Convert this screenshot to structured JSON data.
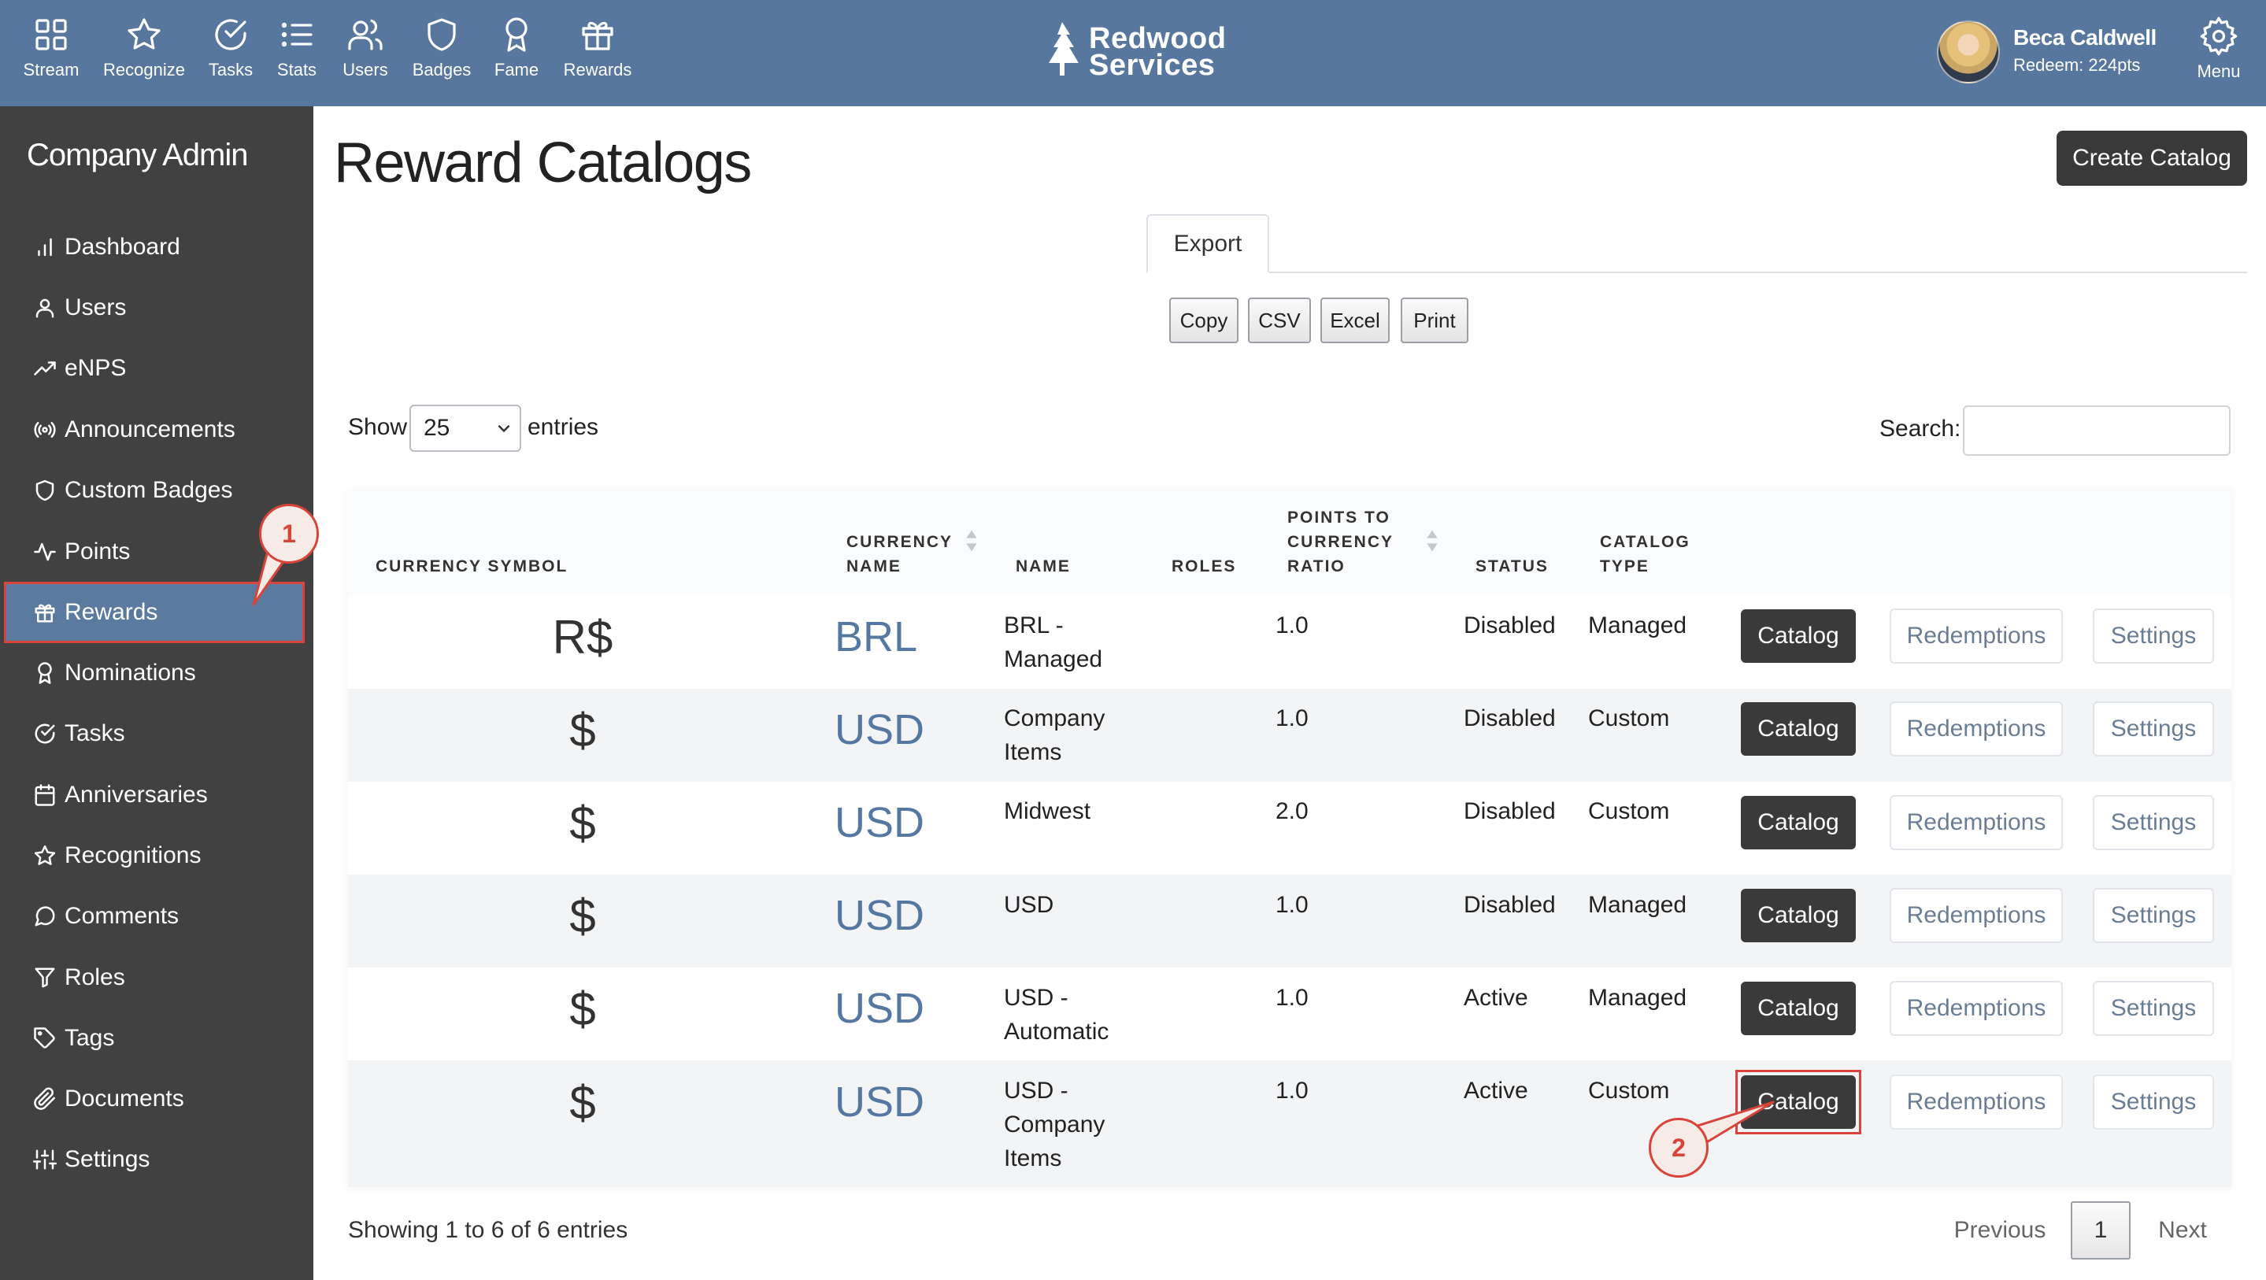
{
  "topnav": {
    "items": [
      {
        "label": "Stream",
        "icon": "grid-icon"
      },
      {
        "label": "Recognize",
        "icon": "star-icon"
      },
      {
        "label": "Tasks",
        "icon": "check-circle-icon"
      },
      {
        "label": "Stats",
        "icon": "list-icon"
      },
      {
        "label": "Users",
        "icon": "users-icon"
      },
      {
        "label": "Badges",
        "icon": "shield-icon"
      },
      {
        "label": "Fame",
        "icon": "award-icon"
      },
      {
        "label": "Rewards",
        "icon": "gift-icon"
      }
    ],
    "brand_line1": "Redwood",
    "brand_line2": "Services",
    "user_name": "Beca Caldwell",
    "user_points": "Redeem: 224pts",
    "menu_label": "Menu"
  },
  "sidebar": {
    "title": "Company Admin",
    "items": [
      {
        "label": "Dashboard",
        "icon": "bar-chart-icon"
      },
      {
        "label": "Users",
        "icon": "user-icon"
      },
      {
        "label": "eNPS",
        "icon": "trending-up-icon"
      },
      {
        "label": "Announcements",
        "icon": "broadcast-icon"
      },
      {
        "label": "Custom Badges",
        "icon": "shield-icon"
      },
      {
        "label": "Points",
        "icon": "activity-icon"
      },
      {
        "label": "Rewards",
        "icon": "gift-icon"
      },
      {
        "label": "Nominations",
        "icon": "award-icon"
      },
      {
        "label": "Tasks",
        "icon": "check-circle-icon"
      },
      {
        "label": "Anniversaries",
        "icon": "calendar-icon"
      },
      {
        "label": "Recognitions",
        "icon": "star-icon"
      },
      {
        "label": "Comments",
        "icon": "message-circle-icon"
      },
      {
        "label": "Roles",
        "icon": "filter-icon"
      },
      {
        "label": "Tags",
        "icon": "tag-icon"
      },
      {
        "label": "Documents",
        "icon": "paperclip-icon"
      },
      {
        "label": "Settings",
        "icon": "sliders-icon"
      }
    ],
    "active_item": "Rewards"
  },
  "main": {
    "title": "Reward Catalogs",
    "create_button": "Create Catalog",
    "tab_export": "Export",
    "export_buttons": [
      "Copy",
      "CSV",
      "Excel",
      "Print"
    ],
    "show_label": "Show",
    "show_value": "25",
    "entries_label": "entries",
    "search_label": "Search:",
    "search_value": ""
  },
  "table": {
    "headers": {
      "currency_symbol": "CURRENCY SYMBOL",
      "currency_name_1": "CURRENCY",
      "currency_name_2": "NAME",
      "name": "NAME",
      "roles": "ROLES",
      "ratio_1": "POINTS TO",
      "ratio_2": "CURRENCY",
      "ratio_3": "RATIO",
      "status": "STATUS",
      "catalog_type_1": "CATALOG",
      "catalog_type_2": "TYPE"
    },
    "rows": [
      {
        "symbol": "R$",
        "currency": "BRL",
        "name_lines": [
          "BRL -",
          "Managed"
        ],
        "roles": "",
        "ratio": "1.0",
        "status": "Disabled",
        "type": "Managed"
      },
      {
        "symbol": "$",
        "currency": "USD",
        "name_lines": [
          "Company",
          "Items"
        ],
        "roles": "",
        "ratio": "1.0",
        "status": "Disabled",
        "type": "Custom"
      },
      {
        "symbol": "$",
        "currency": "USD",
        "name_lines": [
          "Midwest"
        ],
        "roles": "",
        "ratio": "2.0",
        "status": "Disabled",
        "type": "Custom"
      },
      {
        "symbol": "$",
        "currency": "USD",
        "name_lines": [
          "USD"
        ],
        "roles": "",
        "ratio": "1.0",
        "status": "Disabled",
        "type": "Managed"
      },
      {
        "symbol": "$",
        "currency": "USD",
        "name_lines": [
          "USD -",
          "Automatic"
        ],
        "roles": "",
        "ratio": "1.0",
        "status": "Active",
        "type": "Managed"
      },
      {
        "symbol": "$",
        "currency": "USD",
        "name_lines": [
          "USD -",
          "Company",
          "Items"
        ],
        "roles": "",
        "ratio": "1.0",
        "status": "Active",
        "type": "Custom"
      }
    ],
    "action_labels": {
      "catalog": "Catalog",
      "redemptions": "Redemptions",
      "settings": "Settings"
    }
  },
  "footer": {
    "info": "Showing 1 to 6 of 6 entries",
    "previous": "Previous",
    "page": "1",
    "next": "Next"
  },
  "annotations": {
    "callout_1": "1",
    "callout_2": "2",
    "color": "#d9443a"
  }
}
